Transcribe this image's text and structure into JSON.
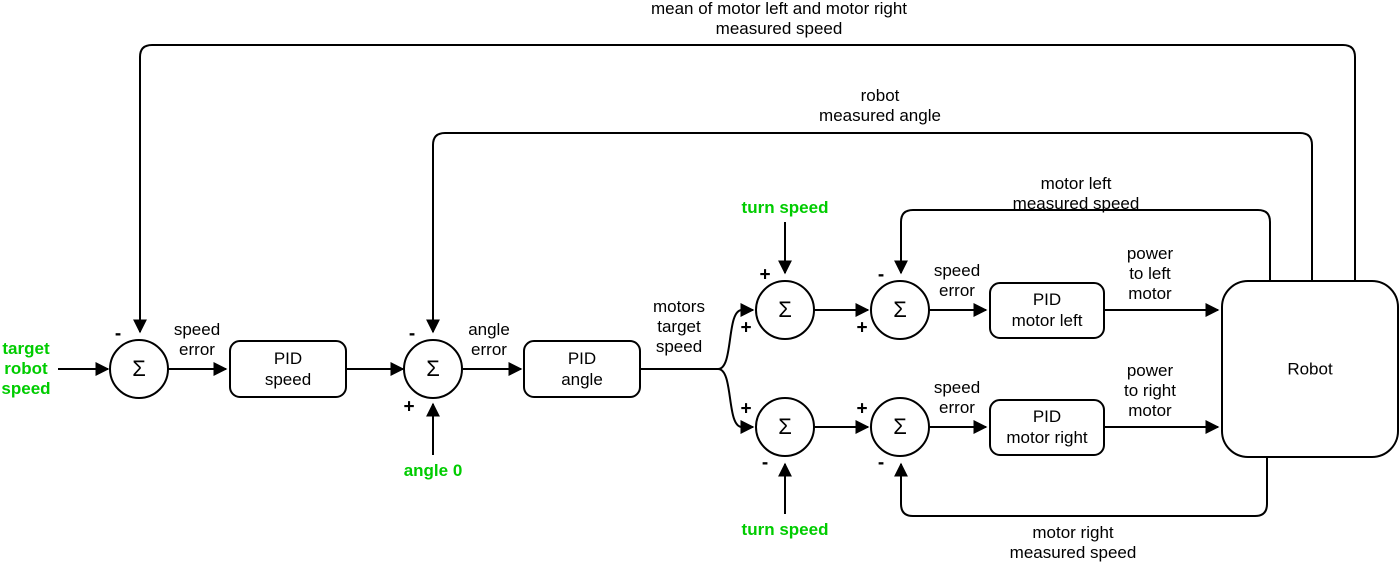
{
  "diagram": {
    "title": "robot cascaded PID control block diagram",
    "colors": {
      "line": "#000000",
      "text": "#000000",
      "input_label": "#00cc00",
      "background": "#ffffff"
    },
    "inputs": [
      {
        "name": "target-robot-speed",
        "label": "target\nrobot\nspeed"
      },
      {
        "name": "angle-0",
        "label": "angle 0"
      },
      {
        "name": "turn-speed-left",
        "label": "turn speed"
      },
      {
        "name": "turn-speed-right",
        "label": "turn speed"
      }
    ],
    "junctions": [
      {
        "name": "sum-speed",
        "symbol": "Σ",
        "signs": {
          "top": "-",
          "left": ""
        }
      },
      {
        "name": "sum-angle",
        "symbol": "Σ",
        "signs": {
          "top": "-",
          "bottom": "+"
        }
      },
      {
        "name": "sum-motor-left-turn",
        "symbol": "Σ",
        "signs": {
          "top": "+",
          "left": "+"
        }
      },
      {
        "name": "sum-motor-left-speed",
        "symbol": "Σ",
        "signs": {
          "top": "-",
          "left": "+"
        }
      },
      {
        "name": "sum-motor-right-turn",
        "symbol": "Σ",
        "signs": {
          "left": "+",
          "bottom": "-"
        }
      },
      {
        "name": "sum-motor-right-speed",
        "symbol": "Σ",
        "signs": {
          "left": "+",
          "bottom": "-"
        }
      }
    ],
    "blocks": [
      {
        "name": "pid-speed",
        "line1": "PID",
        "line2": "speed"
      },
      {
        "name": "pid-angle",
        "line1": "PID",
        "line2": "angle"
      },
      {
        "name": "pid-motor-left",
        "line1": "PID",
        "line2": "motor left"
      },
      {
        "name": "pid-motor-right",
        "line1": "PID",
        "line2": "motor right"
      },
      {
        "name": "robot",
        "line1": "Robot",
        "line2": ""
      }
    ],
    "signals": {
      "speed_error_1": "speed\nerror",
      "angle_error": "angle\nerror",
      "motors_target_speed": "motors\ntarget\nspeed",
      "speed_error_left": "speed\nerror",
      "speed_error_right": "speed\nerror",
      "power_to_left_motor": "power\nto left\nmotor",
      "power_to_right_motor": "power\nto right\nmotor",
      "mean_measured_speed": "mean of motor left and motor right\nmeasured speed",
      "robot_measured_angle": "robot\nmeasured angle",
      "motor_left_measured_speed": "motor left\nmeasured speed",
      "motor_right_measured_speed": "motor right\nmeasured speed"
    },
    "signs": {
      "sum_speed_minus": "-",
      "sum_angle_minus": "-",
      "sum_angle_plus": "+",
      "ml_turn_plus_top": "+",
      "ml_turn_plus_left": "+",
      "ml_speed_minus": "-",
      "ml_speed_plus": "+",
      "mr_turn_plus": "+",
      "mr_turn_minus": "-",
      "mr_speed_plus": "+",
      "mr_speed_minus": "-"
    },
    "sigma": "Σ"
  }
}
